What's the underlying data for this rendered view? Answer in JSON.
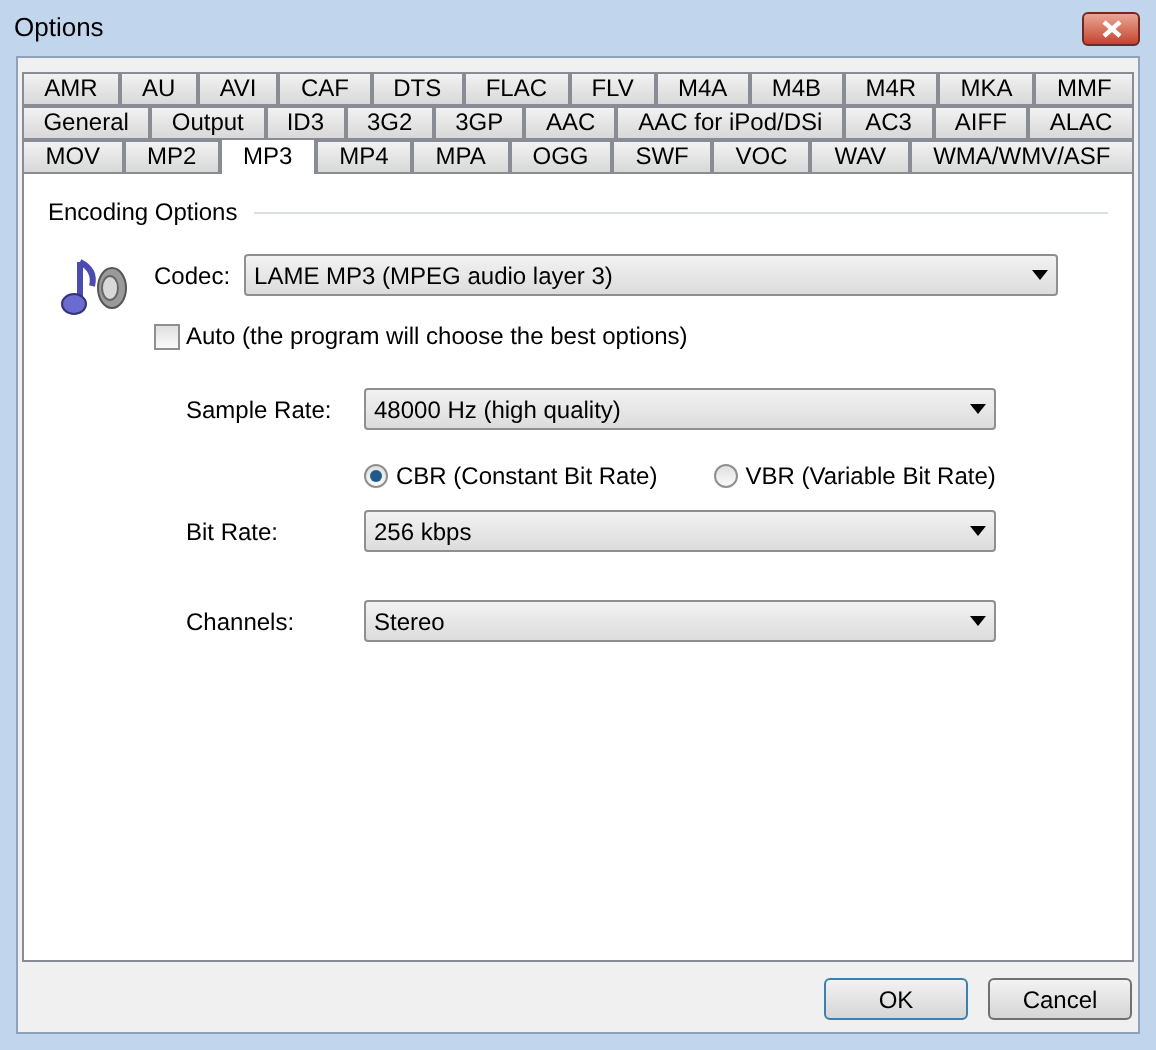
{
  "window": {
    "title": "Options"
  },
  "tab_rows": [
    [
      {
        "label": "AMR",
        "selected": false
      },
      {
        "label": "AU",
        "selected": false
      },
      {
        "label": "AVI",
        "selected": false
      },
      {
        "label": "CAF",
        "selected": false
      },
      {
        "label": "DTS",
        "selected": false
      },
      {
        "label": "FLAC",
        "selected": false
      },
      {
        "label": "FLV",
        "selected": false
      },
      {
        "label": "M4A",
        "selected": false
      },
      {
        "label": "M4B",
        "selected": false
      },
      {
        "label": "M4R",
        "selected": false
      },
      {
        "label": "MKA",
        "selected": false
      },
      {
        "label": "MMF",
        "selected": false
      }
    ],
    [
      {
        "label": "General",
        "selected": false
      },
      {
        "label": "Output",
        "selected": false
      },
      {
        "label": "ID3",
        "selected": false
      },
      {
        "label": "3G2",
        "selected": false
      },
      {
        "label": "3GP",
        "selected": false
      },
      {
        "label": "AAC",
        "selected": false
      },
      {
        "label": "AAC for iPod/DSi",
        "selected": false
      },
      {
        "label": "AC3",
        "selected": false
      },
      {
        "label": "AIFF",
        "selected": false
      },
      {
        "label": "ALAC",
        "selected": false
      }
    ],
    [
      {
        "label": "MOV",
        "selected": false
      },
      {
        "label": "MP2",
        "selected": false
      },
      {
        "label": "MP3",
        "selected": true
      },
      {
        "label": "MP4",
        "selected": false
      },
      {
        "label": "MPA",
        "selected": false
      },
      {
        "label": "OGG",
        "selected": false
      },
      {
        "label": "SWF",
        "selected": false
      },
      {
        "label": "VOC",
        "selected": false
      },
      {
        "label": "WAV",
        "selected": false
      },
      {
        "label": "WMA/WMV/ASF",
        "selected": false
      }
    ]
  ],
  "group": {
    "title": "Encoding Options"
  },
  "codec": {
    "label": "Codec:",
    "value": "LAME MP3 (MPEG audio layer 3)"
  },
  "auto": {
    "label": "Auto (the program will choose the best options)",
    "checked": false
  },
  "sample_rate": {
    "label": "Sample Rate:",
    "value": "48000 Hz (high quality)"
  },
  "bitrate_modes": [
    {
      "label": "CBR (Constant Bit Rate)",
      "selected": true
    },
    {
      "label": "VBR (Variable Bit Rate)",
      "selected": false
    }
  ],
  "bit_rate": {
    "label": "Bit Rate:",
    "value": "256 kbps"
  },
  "channels": {
    "label": "Channels:",
    "value": "Stereo"
  },
  "buttons": [
    "OK",
    "Cancel"
  ]
}
